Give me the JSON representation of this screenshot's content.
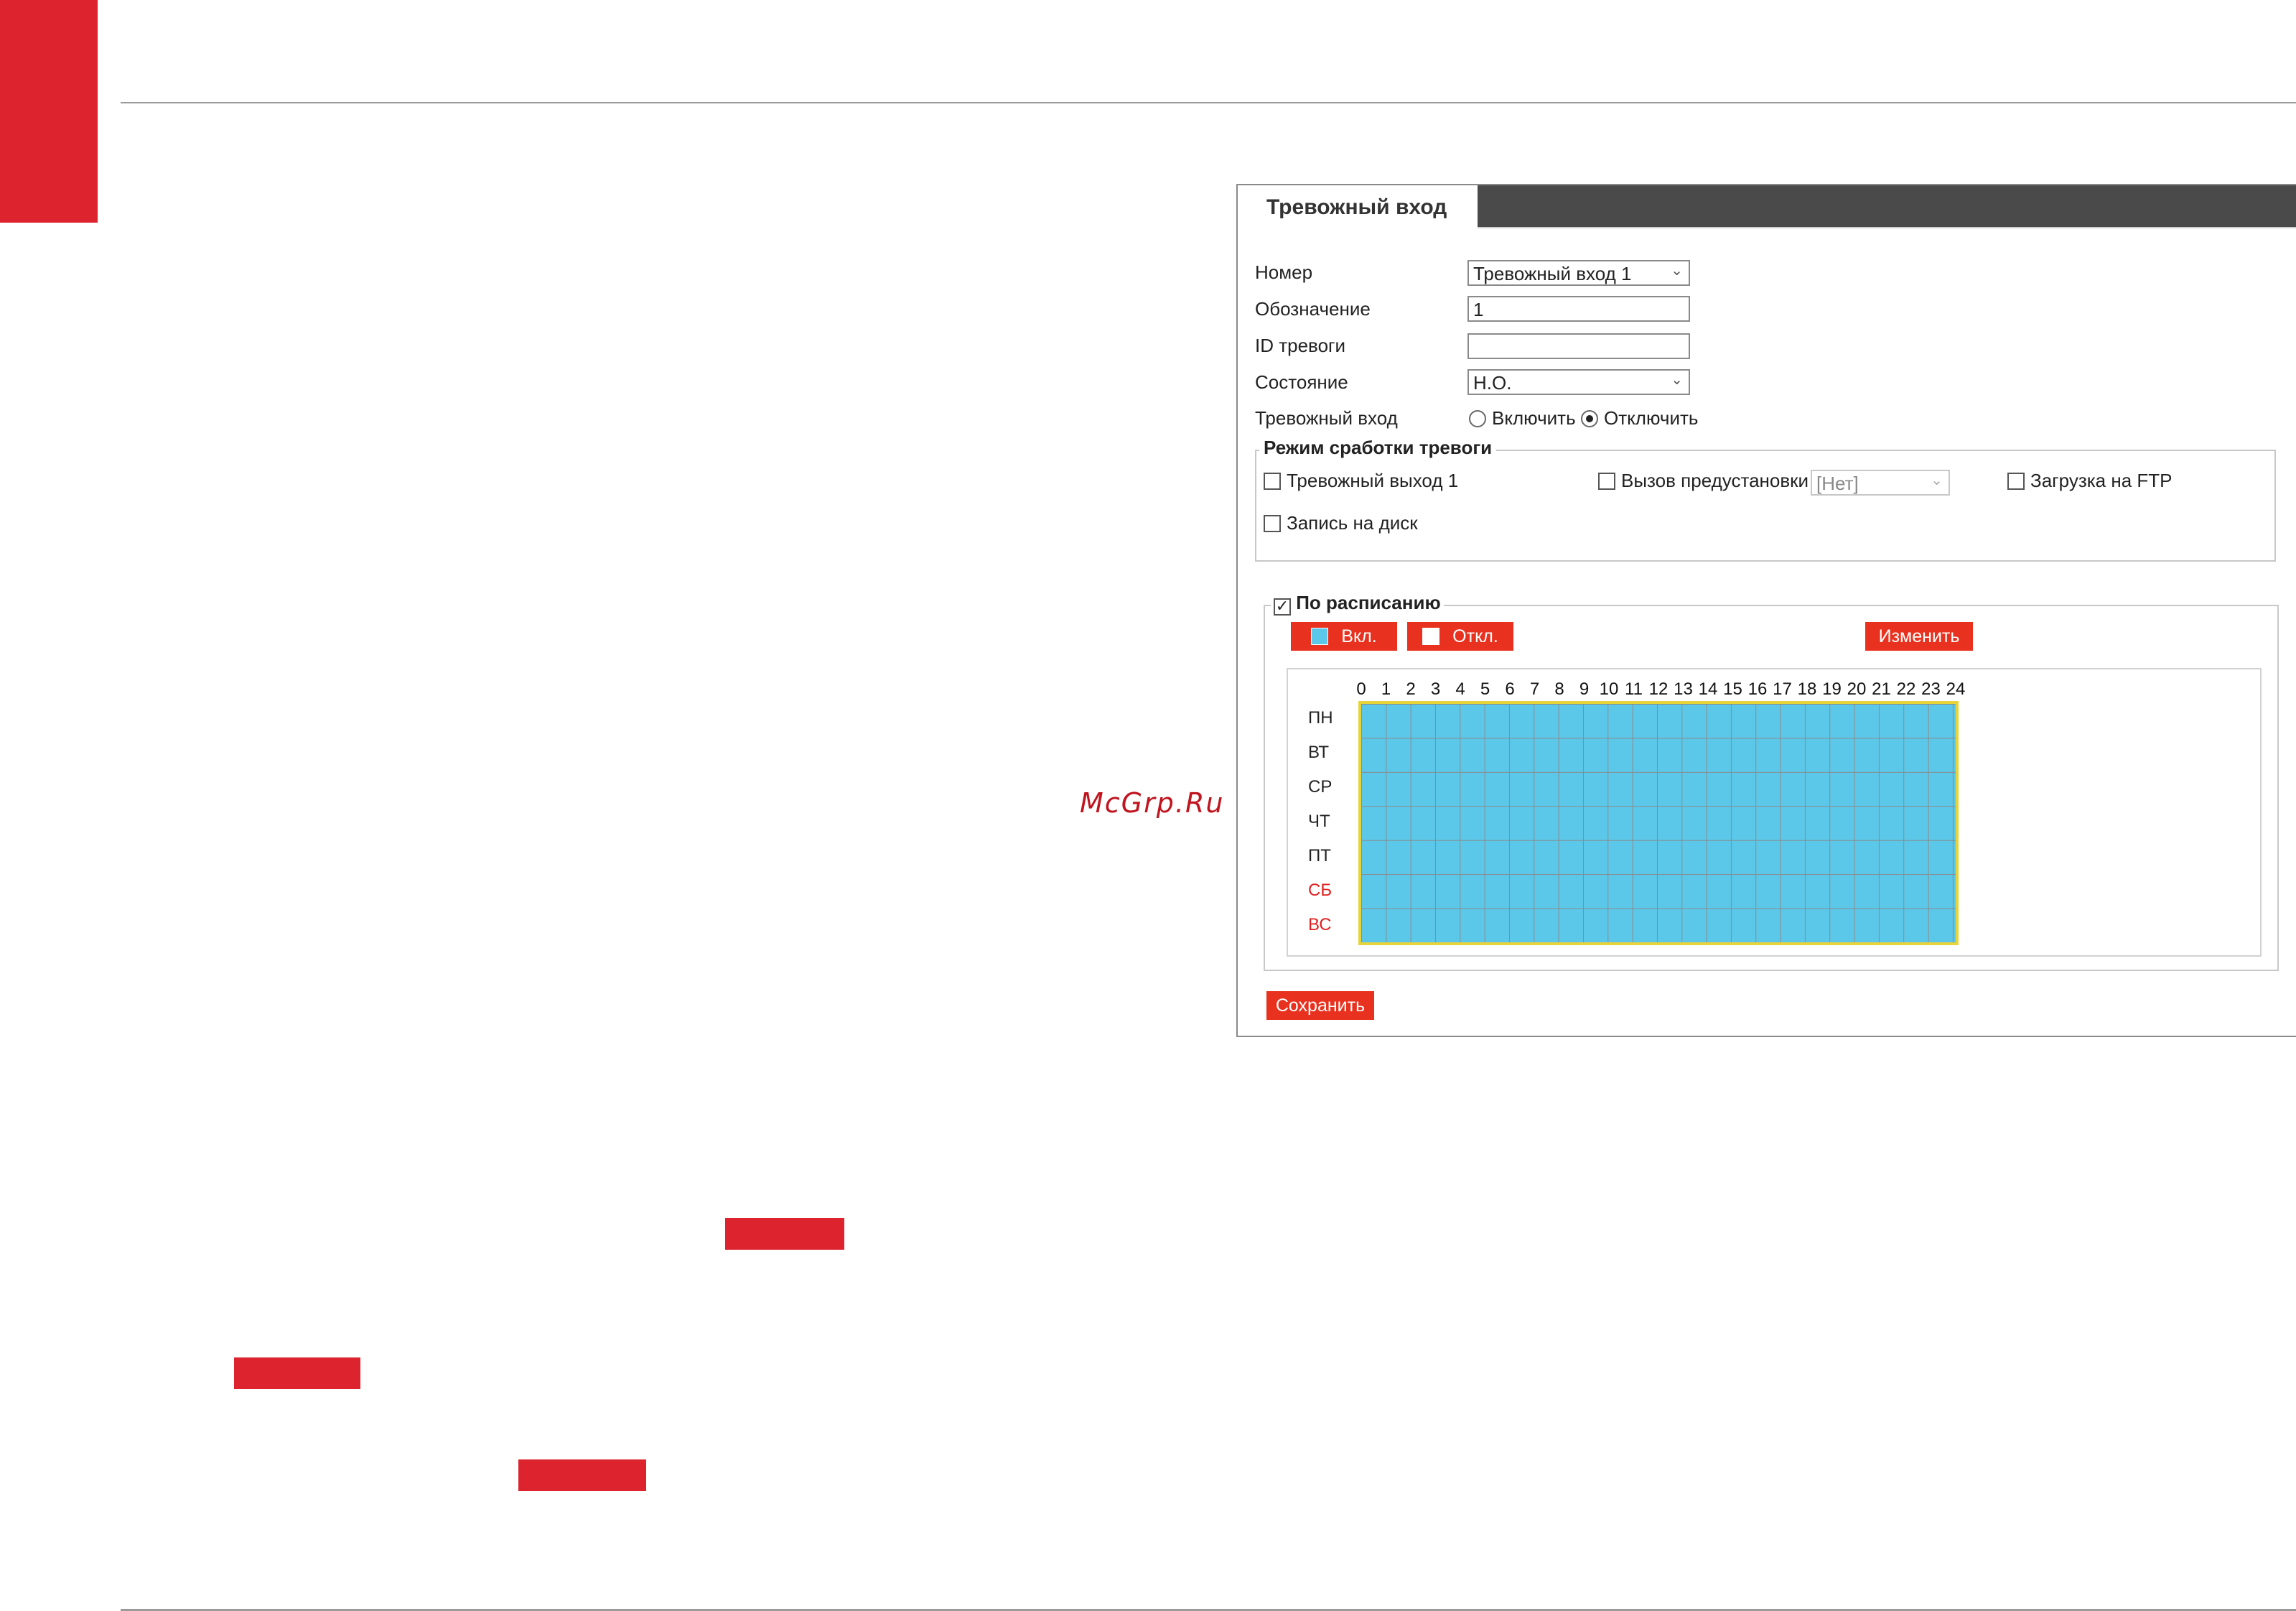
{
  "panel": {
    "title": "Тревожный вход",
    "fields": {
      "number_label": "Номер",
      "number_value": "Тревожный вход 1",
      "designation_label": "Обозначение",
      "designation_value": "1",
      "alarm_id_label": "ID тревоги",
      "alarm_id_value": "",
      "state_label": "Состояние",
      "state_value": "Н.О.",
      "alarm_input_label": "Тревожный вход",
      "enable_label": "Включить",
      "disable_label": "Отключить",
      "alarm_input_selected": "Отключить"
    },
    "trigger_mode": {
      "legend": "Режим сработки тревоги",
      "alarm_output_label": "Тревожный выход 1",
      "alarm_output_checked": false,
      "preset_call_label": "Вызов предустановки",
      "preset_call_checked": false,
      "preset_value": "[Нет]",
      "ftp_label": "Загрузка на FTP",
      "ftp_checked": false,
      "disk_record_label": "Запись на диск",
      "disk_record_checked": false
    },
    "schedule": {
      "legend": "По расписанию",
      "enabled": true,
      "on_button": "Вкл.",
      "off_button": "Откл.",
      "edit_button": "Изменить",
      "on_color": "#5bc8ea",
      "hours": [
        "0",
        "1",
        "2",
        "3",
        "4",
        "5",
        "6",
        "7",
        "8",
        "9",
        "10",
        "11",
        "12",
        "13",
        "14",
        "15",
        "16",
        "17",
        "18",
        "19",
        "20",
        "21",
        "22",
        "23",
        "24"
      ],
      "days": [
        "ПН",
        "ВТ",
        "СР",
        "ЧТ",
        "ПТ",
        "СБ",
        "ВС"
      ],
      "weekend_color": "#e02020"
    },
    "save_button": "Сохранить"
  },
  "watermark": "McGrp.Ru",
  "colors": {
    "brand_red": "#dc232e",
    "button_red": "#e8311e"
  }
}
